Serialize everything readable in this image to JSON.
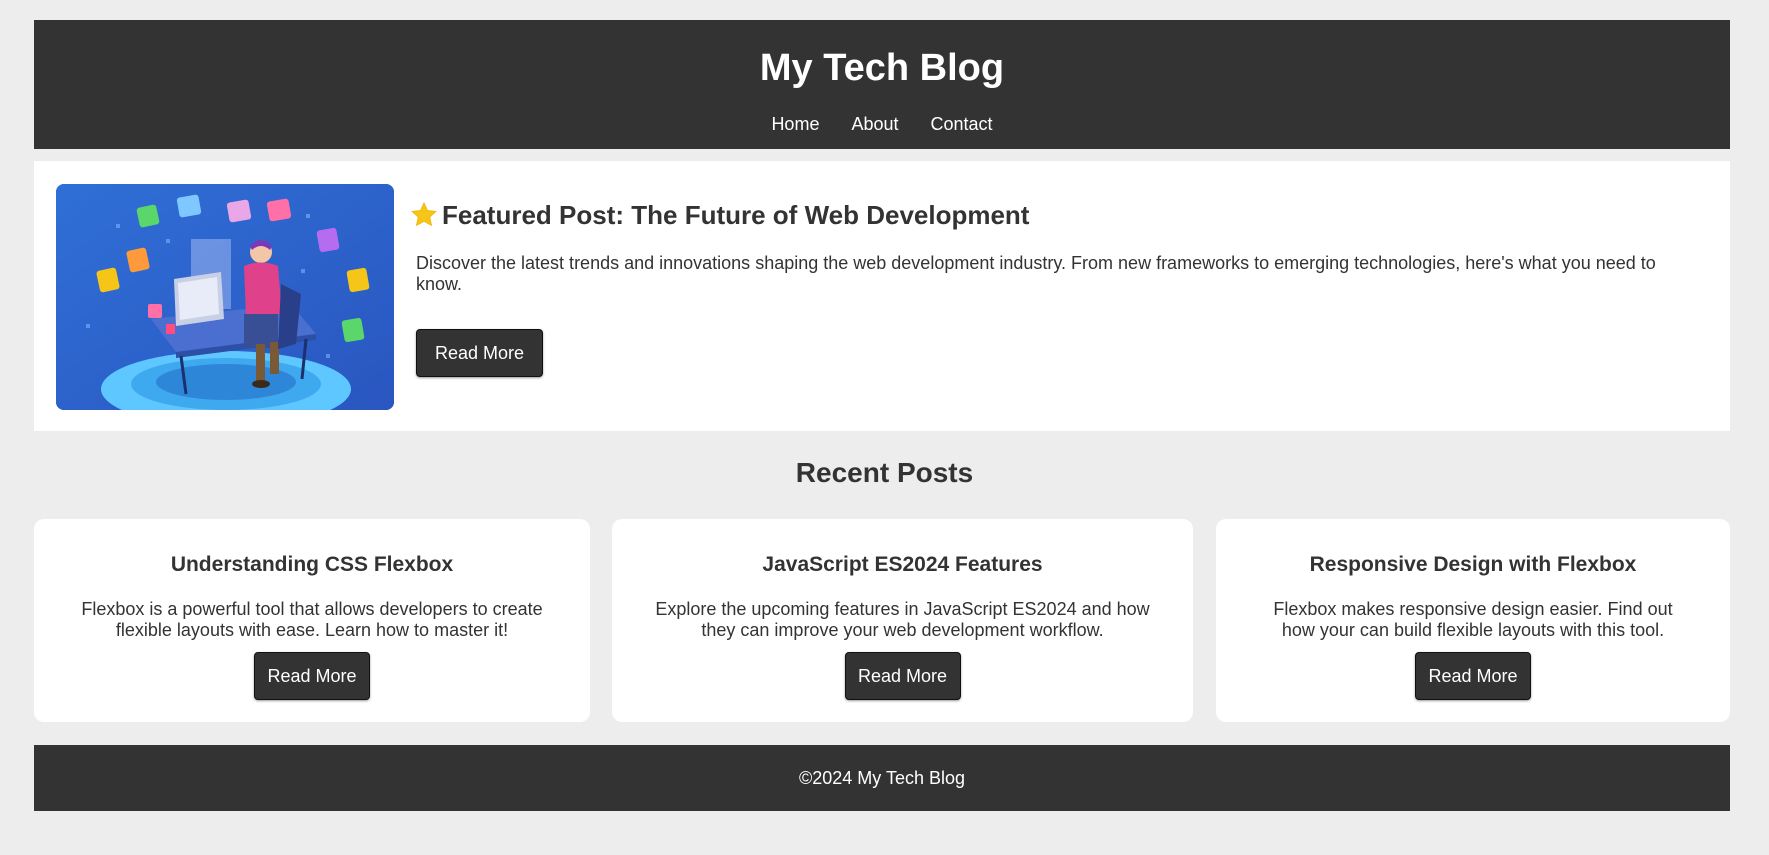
{
  "header": {
    "title": "My Tech Blog",
    "nav": [
      {
        "label": "Home"
      },
      {
        "label": "About"
      },
      {
        "label": "Contact"
      }
    ]
  },
  "featured": {
    "title": "Featured Post: The Future of Web Development",
    "icon": "star-icon",
    "excerpt": "Discover the latest trends and innovations shaping the web development industry. From new frameworks to emerging technologies, here's what you need to know.",
    "button_label": "Read More",
    "image": "developer-illustration"
  },
  "recent": {
    "heading": "Recent Posts",
    "posts": [
      {
        "title": "Understanding CSS Flexbox",
        "excerpt": "Flexbox is a powerful tool that allows developers to create flexible layouts with ease. Learn how to master it!",
        "button_label": "Read More"
      },
      {
        "title": "JavaScript ES2024 Features",
        "excerpt": "Explore the upcoming features in JavaScript ES2024 and how they can improve your web development workflow.",
        "button_label": "Read More"
      },
      {
        "title": "Responsive Design with Flexbox",
        "excerpt": "Flexbox makes responsive design easier. Find out how your can build flexible layouts with this tool.",
        "button_label": "Read More"
      }
    ]
  },
  "footer": {
    "text": "©2024 My Tech Blog"
  },
  "colors": {
    "dark": "#333333",
    "background": "#ededed",
    "card": "#ffffff",
    "star": "#f5c518"
  }
}
